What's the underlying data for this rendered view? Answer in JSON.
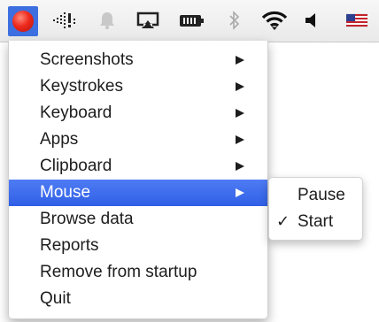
{
  "menubar": {
    "icons": [
      "app-status-icon",
      "activity-monitor-icon",
      "notification-bell-icon",
      "airplay-icon",
      "battery-icon",
      "bluetooth-icon",
      "wifi-icon",
      "volume-icon",
      "us-flag-icon"
    ]
  },
  "menu": {
    "items": [
      {
        "label": "Screenshots",
        "has_submenu": true
      },
      {
        "label": "Keystrokes",
        "has_submenu": true
      },
      {
        "label": "Keyboard",
        "has_submenu": true
      },
      {
        "label": "Apps",
        "has_submenu": true
      },
      {
        "label": "Clipboard",
        "has_submenu": true
      },
      {
        "label": "Mouse",
        "has_submenu": true,
        "highlighted": true
      },
      {
        "label": "Browse data"
      },
      {
        "label": "Reports"
      },
      {
        "label": "Remove from startup"
      },
      {
        "label": "Quit"
      }
    ]
  },
  "submenu": {
    "items": [
      {
        "label": "Pause",
        "checked": false
      },
      {
        "label": "Start",
        "checked": true,
        "check_mark": "✓"
      }
    ]
  },
  "colors": {
    "highlight": "#3366ee",
    "app_icon": "#ee2a1d"
  }
}
